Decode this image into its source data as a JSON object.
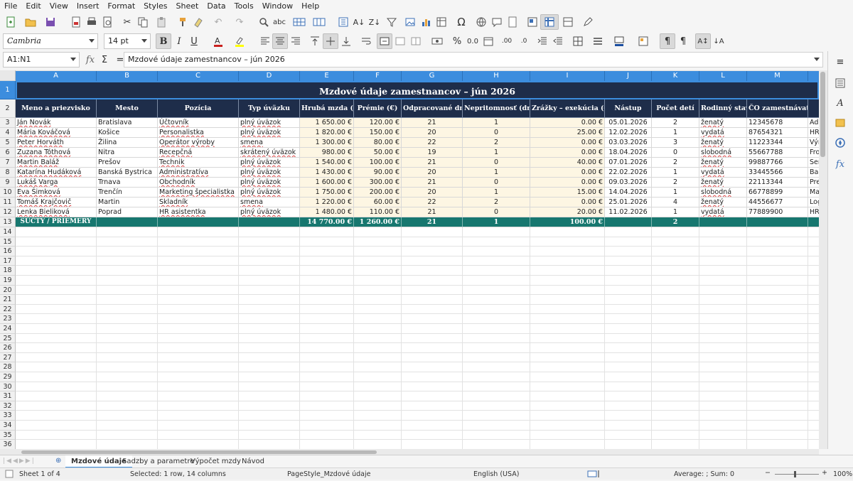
{
  "menu": [
    "File",
    "Edit",
    "View",
    "Insert",
    "Format",
    "Styles",
    "Sheet",
    "Data",
    "Tools",
    "Window",
    "Help"
  ],
  "format_bar": {
    "font_name": "Cambria",
    "font_size": "14 pt",
    "bold": "B",
    "italic": "I",
    "underline": "U"
  },
  "formula_bar": {
    "cell_ref": "A1:N1",
    "content": "Mzdové údaje zamestnancov – jún 2026"
  },
  "columns": [
    "A",
    "B",
    "C",
    "D",
    "E",
    "F",
    "G",
    "H",
    "I",
    "J",
    "K",
    "L",
    "M"
  ],
  "title": "Mzdové údaje zamestnancov – jún 2026",
  "headers": [
    "Meno a priezvisko",
    "Mesto",
    "Pozícia",
    "Typ úväzku",
    "Hrubá mzda (€)",
    "Prémie (€)",
    "Odpracované dni",
    "Nepritomnosť (dni)",
    "Zrážky – exekúcia (€)",
    "Nástup",
    "Počet detí",
    "Rodinný stav",
    "ČO zamestnávateľa"
  ],
  "rows": [
    [
      "Ján Novák",
      "Bratislava",
      "Účtovník",
      "plný úväzok",
      "1 650.00 €",
      "120.00 €",
      "21",
      "1",
      "0.00 €",
      "05.01.2026",
      "2",
      "ženatý",
      "12345678",
      "Adr"
    ],
    [
      "Mária Kováčová",
      "Košice",
      "Personalistka",
      "plný úväzok",
      "1 820.00 €",
      "150.00 €",
      "20",
      "0",
      "25.00 €",
      "12.02.2026",
      "1",
      "vydatá",
      "87654321",
      "HR"
    ],
    [
      "Peter Horváth",
      "Žilina",
      "Operátor výroby",
      "smena",
      "1 300.00 €",
      "80.00 €",
      "22",
      "2",
      "0.00 €",
      "03.03.2026",
      "3",
      "ženatý",
      "11223344",
      "Výr"
    ],
    [
      "Zuzana Tóthová",
      "Nitra",
      "Recepčná",
      "skrátený úväzok",
      "980.00 €",
      "50.00 €",
      "19",
      "1",
      "0.00 €",
      "18.04.2026",
      "0",
      "slobodná",
      "55667788",
      "Fro"
    ],
    [
      "Martin Baláž",
      "Prešov",
      "Technik",
      "plný úväzok",
      "1 540.00 €",
      "100.00 €",
      "21",
      "0",
      "40.00 €",
      "07.01.2026",
      "2",
      "ženatý",
      "99887766",
      "Ser"
    ],
    [
      "Katarína Hudáková",
      "Banská Bystrica",
      "Administratíva",
      "plný úväzok",
      "1 430.00 €",
      "90.00 €",
      "20",
      "1",
      "0.00 €",
      "22.02.2026",
      "1",
      "vydatá",
      "33445566",
      "Bac"
    ],
    [
      "Lukáš Varga",
      "Trnava",
      "Obchodník",
      "plný úväzok",
      "1 600.00 €",
      "300.00 €",
      "21",
      "0",
      "0.00 €",
      "09.03.2026",
      "2",
      "ženatý",
      "22113344",
      "Pre"
    ],
    [
      "Eva Šimková",
      "Trenčín",
      "Marketing špecialistka",
      "plný úväzok",
      "1 750.00 €",
      "200.00 €",
      "20",
      "1",
      "15.00 €",
      "14.04.2026",
      "1",
      "slobodná",
      "66778899",
      "Mar"
    ],
    [
      "Tomáš Krajčovič",
      "Martin",
      "Skladník",
      "smena",
      "1 220.00 €",
      "60.00 €",
      "22",
      "2",
      "0.00 €",
      "25.01.2026",
      "4",
      "ženatý",
      "44556677",
      "Log"
    ],
    [
      "Lenka Bieliková",
      "Poprad",
      "HR asistentka",
      "plný úväzok",
      "1 480.00 €",
      "110.00 €",
      "21",
      "0",
      "20.00 €",
      "11.02.2026",
      "1",
      "vydatá",
      "77889900",
      "HR"
    ]
  ],
  "totals": {
    "label": "SÚČTY / PRIEMERY",
    "gross": "14 770.00 €",
    "bonus": "1 260.00 €",
    "days": "21",
    "absence": "1",
    "deductions": "100.00 €",
    "kids": "2"
  },
  "row_numbers": [
    "1",
    "2",
    "3",
    "4",
    "5",
    "6",
    "7",
    "8",
    "9",
    "10",
    "11",
    "12",
    "13",
    "14",
    "15",
    "16",
    "17",
    "18",
    "19",
    "20",
    "21",
    "22",
    "23",
    "24",
    "25",
    "26",
    "27",
    "28",
    "29",
    "30",
    "31",
    "32",
    "33",
    "34",
    "35",
    "36"
  ],
  "tabs": [
    "Mzdové údaje",
    "Sadzby a parametre",
    "Výpočet mzdy",
    "Návod"
  ],
  "status": {
    "sheet": "Sheet 1 of 4",
    "selection": "Selected: 1 row, 14 columns",
    "pagestyle": "PageStyle_Mzdové údaje",
    "lang": "English (USA)",
    "sum": "Average: ; Sum: 0",
    "zoom": "100%"
  }
}
